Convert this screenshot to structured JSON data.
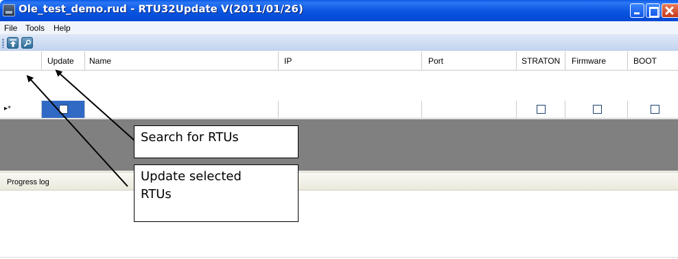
{
  "window": {
    "title": "Ole_test_demo.rud - RTU32Update V(2011/01/26)",
    "title_color": "#0a5ae6",
    "buttons": [
      "minimize-icon",
      "maximize-icon",
      "close-icon"
    ]
  },
  "menubar": {
    "items": [
      {
        "label": "File",
        "mnemonic": "F"
      },
      {
        "label": "Tools",
        "mnemonic": "T"
      },
      {
        "label": "Help",
        "mnemonic": "H"
      }
    ]
  },
  "toolbar": {
    "buttons": [
      {
        "icon": "update-upload-icon",
        "action": "Update selected RTUs"
      },
      {
        "icon": "search-magnifier-icon",
        "action": "Search for RTUs"
      }
    ]
  },
  "grid": {
    "columns": [
      "Update",
      "Name",
      "IP",
      "Port",
      "STRATON",
      "Firmware",
      "BOOT"
    ],
    "new_row_marker": "▸*",
    "rows": [
      {
        "update": false,
        "name": "",
        "ip": "",
        "port": "",
        "straton": false,
        "firmware": false,
        "boot": false
      }
    ],
    "selected_cell_color": "#316ac5",
    "empty_area_color": "#808080"
  },
  "progress_log": {
    "label": "Progress log",
    "content": ""
  },
  "callouts": {
    "search": "Search for RTUs",
    "update_line1": "Update selected",
    "update_line2": "RTUs"
  }
}
